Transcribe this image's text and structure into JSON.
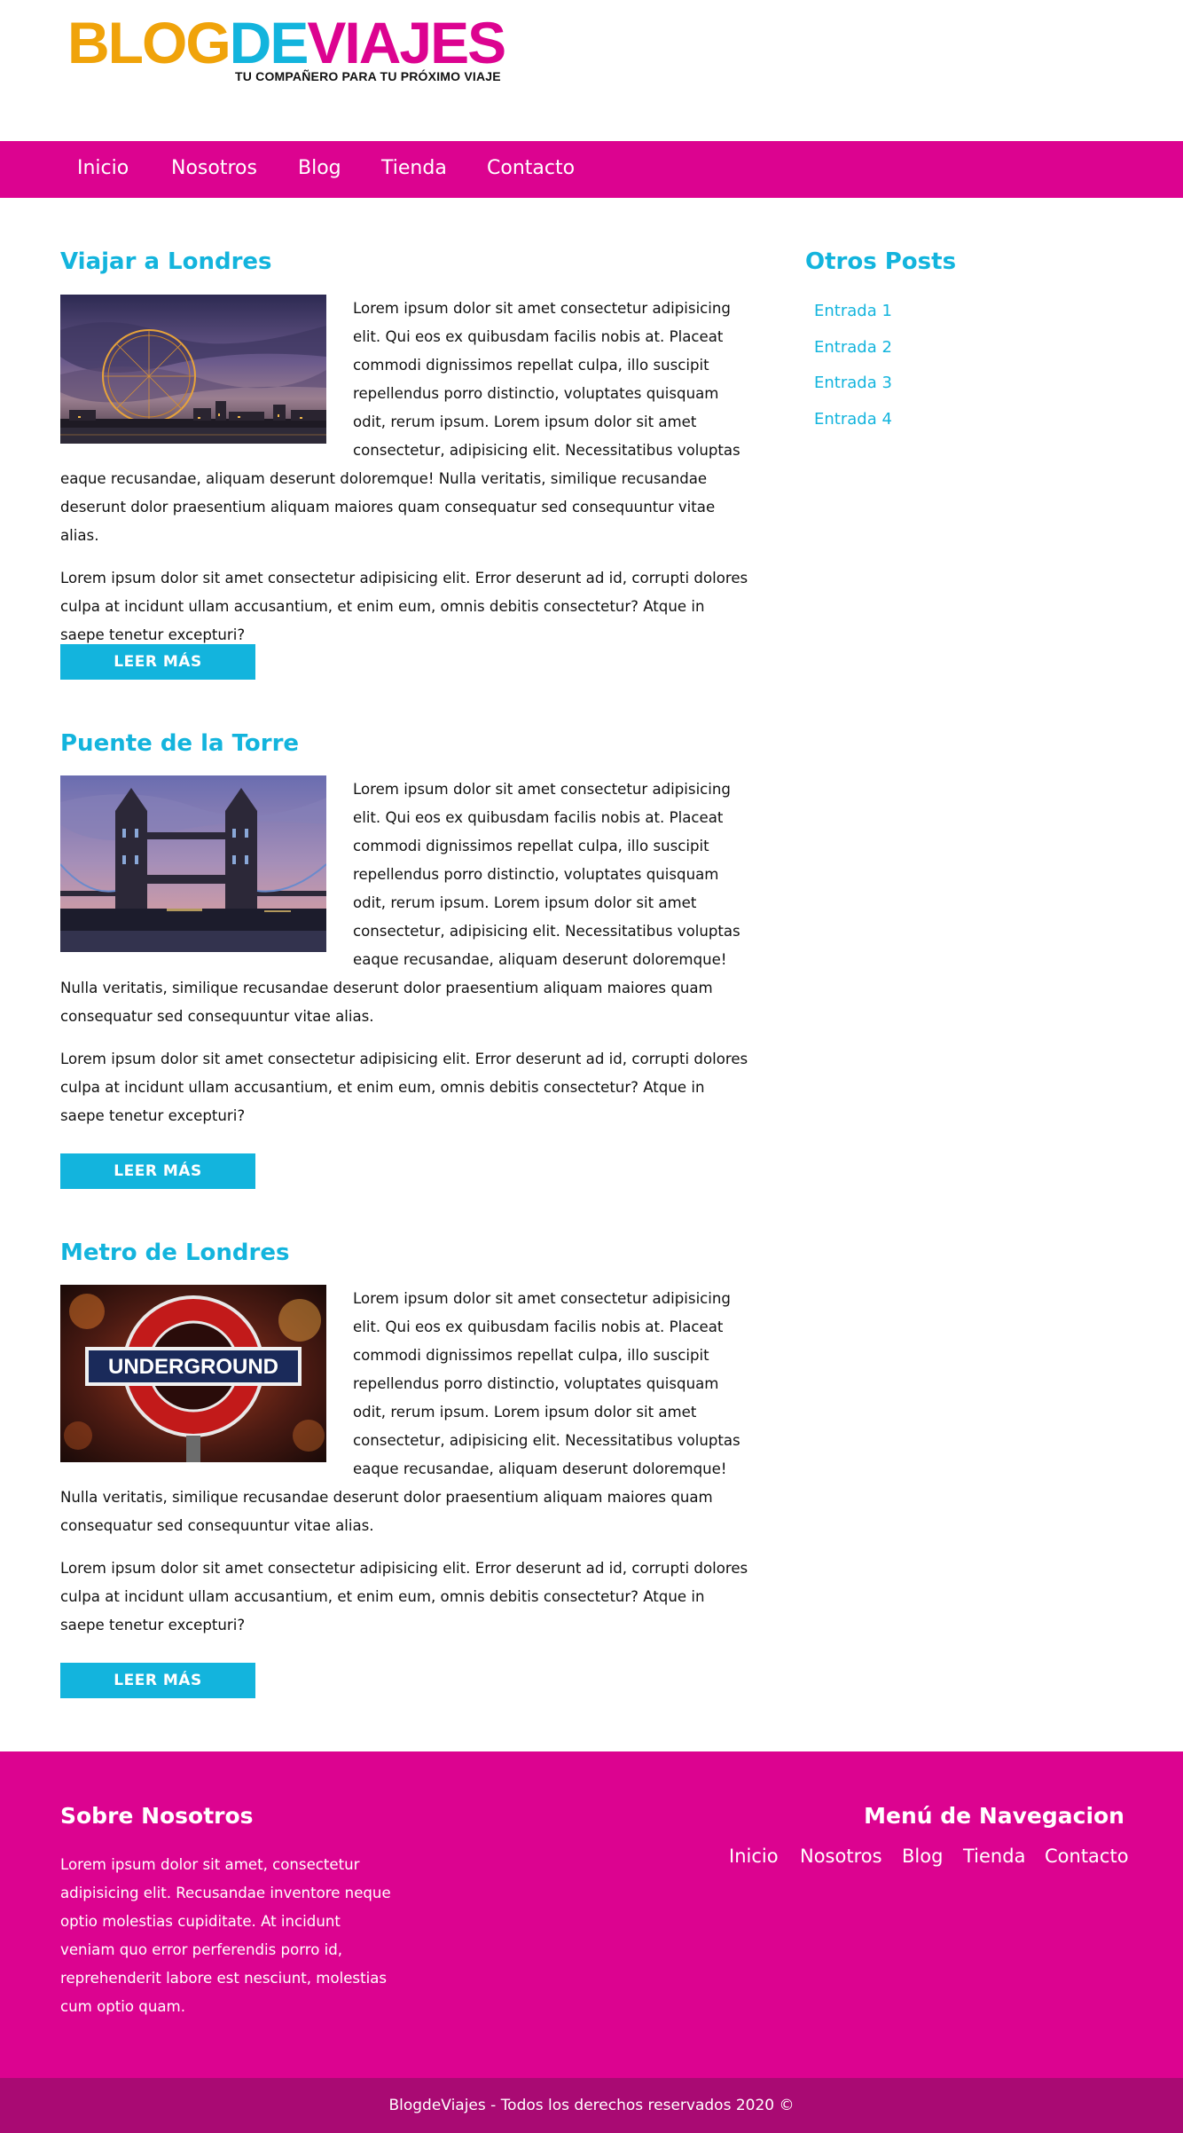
{
  "logo": {
    "part1": "BLOG",
    "part2": "DE",
    "part3": "VIAJES",
    "tagline": "TU COMPAÑERO PARA TU PRÓXIMO VIAJE",
    "colors": {
      "blog": "#f0a30a",
      "de": "#13b4dd",
      "viajes": "#dc0390"
    }
  },
  "nav": {
    "items": [
      "Inicio",
      "Nosotros",
      "Blog",
      "Tienda",
      "Contacto"
    ],
    "background": "#dc0390"
  },
  "posts": [
    {
      "title": "Viajar a Londres",
      "image": "london-eye-photo",
      "paragraph1": "Lorem ipsum dolor sit amet consectetur adipisicing elit. Qui eos ex quibusdam facilis nobis at. Placeat commodi dignissimos repellat culpa, illo suscipit repellendus porro distinctio, voluptates quisquam odit, rerum ipsum. Lorem ipsum dolor sit amet consectetur, adipisicing elit. Necessitatibus voluptas eaque recusandae, aliquam deserunt doloremque! Nulla veritatis, similique recusandae deserunt dolor praesentium aliquam maiores quam consequatur sed consequuntur vitae alias.",
      "paragraph2": "Lorem ipsum dolor sit amet consectetur adipisicing elit. Error deserunt ad id, corrupti dolores culpa at incidunt ullam accusantium, et enim eum, omnis debitis consectetur? Atque in saepe tenetur excepturi?",
      "button": "LEER MÁS"
    },
    {
      "title": "Puente de la Torre",
      "image": "tower-bridge-photo",
      "paragraph1": "Lorem ipsum dolor sit amet consectetur adipisicing elit. Qui eos ex quibusdam facilis nobis at. Placeat commodi dignissimos repellat culpa, illo suscipit repellendus porro distinctio, voluptates quisquam odit, rerum ipsum. Lorem ipsum dolor sit amet consectetur, adipisicing elit. Necessitatibus voluptas eaque recusandae, aliquam deserunt doloremque! Nulla veritatis, similique recusandae deserunt dolor praesentium aliquam maiores quam consequatur sed consequuntur vitae alias.",
      "paragraph2": "Lorem ipsum dolor sit amet consectetur adipisicing elit. Error deserunt ad id, corrupti dolores culpa at incidunt ullam accusantium, et enim eum, omnis debitis consectetur? Atque in saepe tenetur excepturi?",
      "button": "LEER MÁS"
    },
    {
      "title": "Metro de Londres",
      "image": "underground-sign-photo",
      "sign_text": "UNDERGROUND",
      "paragraph1": "Lorem ipsum dolor sit amet consectetur adipisicing elit. Qui eos ex quibusdam facilis nobis at. Placeat commodi dignissimos repellat culpa, illo suscipit repellendus porro distinctio, voluptates quisquam odit, rerum ipsum. Lorem ipsum dolor sit amet consectetur, adipisicing elit. Necessitatibus voluptas eaque recusandae, aliquam deserunt doloremque! Nulla veritatis, similique recusandae deserunt dolor praesentium aliquam maiores quam consequatur sed consequuntur vitae alias.",
      "paragraph2": "Lorem ipsum dolor sit amet consectetur adipisicing elit. Error deserunt ad id, corrupti dolores culpa at incidunt ullam accusantium, et enim eum, omnis debitis consectetur? Atque in saepe tenetur excepturi?",
      "button": "LEER MÁS"
    }
  ],
  "sidebar": {
    "title": "Otros Posts",
    "links": [
      "Entrada 1",
      "Entrada 2",
      "Entrada 3",
      "Entrada 4"
    ]
  },
  "footer": {
    "about_title": "Sobre Nosotros",
    "about_text": "Lorem ipsum dolor sit amet, consectetur adipisicing elit. Recusandae inventore neque optio molestias cupiditate. At incidunt veniam quo error perferendis porro id, reprehenderit labore est nesciunt, molestias cum optio quam.",
    "menu_title": "Menú de Navegacion",
    "menu_items": [
      "Inicio",
      "Nosotros",
      "Blog",
      "Tienda",
      "Contacto"
    ],
    "copyright": "BlogdeViajes - Todos los derechos reservados 2020 ©"
  },
  "colors": {
    "accent": "#13b4dd",
    "brand": "#dc0390",
    "footer_bottom": "#a90a73"
  }
}
